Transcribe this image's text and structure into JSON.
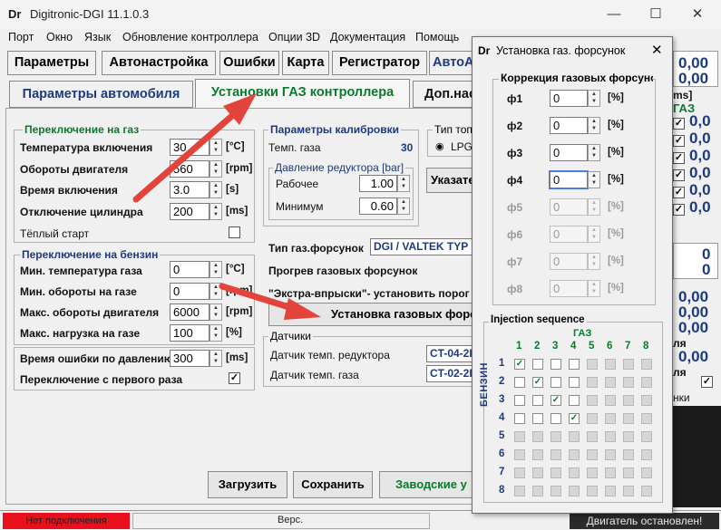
{
  "window": {
    "title": "Digitronic-DGI  11.1.0.3",
    "logo": "Dr",
    "minimize": "—",
    "maximize": "☐",
    "close": "✕"
  },
  "menu": [
    "Порт",
    "Окно",
    "Язык",
    "Обновление контроллера",
    "Опции 3D",
    "Документация",
    "Помощь"
  ],
  "tabs_main": [
    "Параметры",
    "Автонастройка",
    "Ошибки",
    "Карта",
    "Регистратор",
    "АвтоА"
  ],
  "tabs_sub": [
    "Параметры автомобиля",
    "Установки ГАЗ контроллера",
    "Доп.нас"
  ],
  "gas_switch": {
    "title": "Переключение на газ",
    "rows": [
      {
        "label": "Температура включения",
        "value": "30",
        "unit": "[°C]"
      },
      {
        "label": "Обороты двигателя",
        "value": "560",
        "unit": "[rpm]"
      },
      {
        "label": "Время включения",
        "value": "3.0",
        "unit": "[s]"
      },
      {
        "label": "Отключение цилиндра",
        "value": "200",
        "unit": "[ms]"
      }
    ],
    "warm_start": "Тёплый старт"
  },
  "petrol_switch": {
    "title": "Переключение на бензин",
    "rows": [
      {
        "label": "Мин. температура газа",
        "value": "0",
        "unit": "[°C]"
      },
      {
        "label": "Мин. обороты на газе",
        "value": "0",
        "unit": "[rpm]"
      },
      {
        "label": "Макс. обороты двигателя",
        "value": "6000",
        "unit": "[rpm]"
      },
      {
        "label": "Макс. нагрузка на газе",
        "value": "100",
        "unit": "[%]"
      }
    ]
  },
  "pressure_error": {
    "label": "Время ошибки по давлению",
    "value": "300",
    "unit": "[ms]"
  },
  "first_switch": {
    "label": "Переключение с первого раза",
    "checked": "✓"
  },
  "calibration": {
    "title": "Параметры калибровки",
    "gas_temp_label": "Темп. газа",
    "gas_temp_value": "30",
    "pressure_title": "Давление редуктора [bar]",
    "work_label": "Рабочее",
    "work_value": "1.00",
    "min_label": "Минимум",
    "min_value": "0.60"
  },
  "fuel_type": {
    "title": "Тип топ",
    "option": "LPG"
  },
  "indicator_button": "Указате",
  "injector_type": {
    "label": "Тип газ.форсунок",
    "value": "DGI / VALTEK TYP"
  },
  "injector_warmup": "Прогрев газовых форсунок",
  "extra_injection": "\"Экстра-впрыски\"- установить порог",
  "injector_settings_button": "Установка газовых форсу",
  "sensors": {
    "title": "Датчики",
    "reducer_label": "Датчик темп. редуктора",
    "reducer_value": "CT-04-2I",
    "gas_label": "Датчик темп. газа",
    "gas_value": "CT-02-2I"
  },
  "bottom_buttons": {
    "load": "Загрузить",
    "save": "Сохранить",
    "factory": "Заводские у"
  },
  "status": {
    "connection": "Нет подключения",
    "version": "Верс.",
    "engine": "Двигатель остановлен!"
  },
  "right_panel": {
    "v1": "0,00",
    "v2": "0,00",
    "ms": "ms]",
    "gas": "ГАЗ",
    "col": [
      "0,0",
      "0,0",
      "0,0",
      "0,0",
      "0,0",
      "0,0"
    ],
    "z1": "0",
    "z2": "0",
    "q": [
      "0,00",
      "0,00",
      "0,00"
    ],
    "q4": "0,00",
    "ya": "ля",
    "ya2": "ля",
    "nki": "нки"
  },
  "dialog": {
    "logo": "Dr",
    "title": "Установка газ. форсунок",
    "close": "✕",
    "correction_title": "Коррекция газовых форсунок",
    "injectors": [
      {
        "label": "ф1",
        "value": "0",
        "unit": "[%]"
      },
      {
        "label": "ф2",
        "value": "0",
        "unit": "[%]"
      },
      {
        "label": "ф3",
        "value": "0",
        "unit": "[%]"
      },
      {
        "label": "ф4",
        "value": "0",
        "unit": "[%]"
      },
      {
        "label": "ф5",
        "value": "0",
        "unit": "[%]"
      },
      {
        "label": "ф6",
        "value": "0",
        "unit": "[%]"
      },
      {
        "label": "ф7",
        "value": "0",
        "unit": "[%]"
      },
      {
        "label": "ф8",
        "value": "0",
        "unit": "[%]"
      }
    ],
    "sequence_title": "Injection sequence",
    "gas_axis": "ГАЗ",
    "petrol_axis": "БЕНЗИН",
    "cols": [
      "1",
      "2",
      "3",
      "4",
      "5",
      "6",
      "7",
      "8"
    ],
    "rows": [
      "1",
      "2",
      "3",
      "4",
      "5",
      "6",
      "7",
      "8"
    ],
    "check": "✓"
  },
  "colors": {
    "accent": "#1d3a7e",
    "green": "#0a7a2a",
    "error": "#e8101a",
    "arrow": "#e2433b"
  }
}
